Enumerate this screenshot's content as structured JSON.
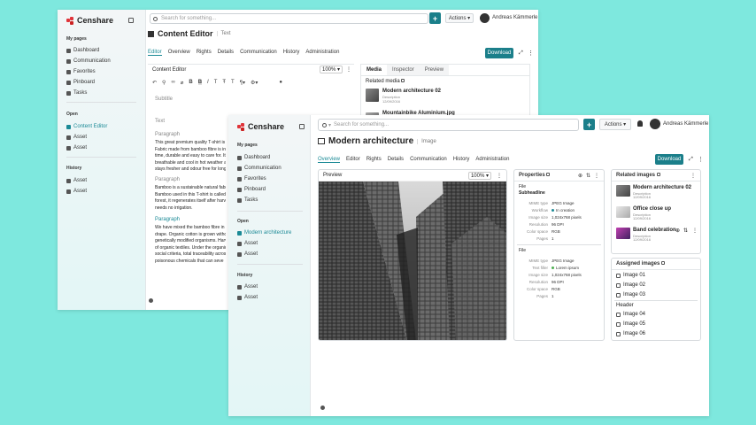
{
  "back": {
    "brand": "Censhare",
    "sidebar": {
      "my_pages_title": "My pages",
      "items": [
        "Dashboard",
        "Communication",
        "Favorites",
        "Pinboard",
        "Tasks"
      ],
      "open_title": "Open",
      "open_items": [
        "Content Editor",
        "Asset",
        "Asset"
      ],
      "history_title": "History",
      "history_items": [
        "Asset",
        "Asset"
      ]
    },
    "search_placeholder": "Search for something...",
    "actions_label": "Actions",
    "user_name": "Andreas Kämmerle",
    "page_title": "Content Editor",
    "type_label": "Text",
    "tabs": [
      "Editor",
      "Overview",
      "Rights",
      "Details",
      "Communication",
      "History",
      "Administration"
    ],
    "download_label": "Download",
    "editor": {
      "panel_title": "Content Editor",
      "zoom": "100%",
      "subtitle_placeholder": "Subtitle",
      "text_label": "Text",
      "paragraph_1_label": "Paragraph",
      "paragraph_1_lines": [
        "This great premium quality T-shirt is",
        "Fabric made from bamboo fibre is inc",
        "time, durable and easy to care for. It's",
        "breathable and cool in hot weather a",
        "stays fresher and odour free for longe"
      ],
      "paragraph_2_label": "Paragraph",
      "paragraph_2_lines": [
        "Bamboo is a sustainable natural fabr",
        "Bamboo used in this T-shirt is called",
        "forest, it regenerates itself after harv",
        "needs no irrigation."
      ],
      "paragraph_3_label": "Paragraph",
      "paragraph_3_lines": [
        "We have mixed the bamboo fibre in t",
        "drape. Organic cotton is grown withou",
        "genetically modified organisms. Harv",
        "of organic textiles. Under the organic",
        "social criteria, total traceability acros",
        "poisonous chemicals that can seve"
      ]
    },
    "media": {
      "tabs": [
        "Media",
        "Inspector",
        "Preview"
      ],
      "related_title": "Related media",
      "items": [
        {
          "name": "Modern architecture 02",
          "desc": "Description",
          "date": "12/09/2016"
        },
        {
          "name": "Mountainbike Aluminium.jpg",
          "desc": "",
          "date": ""
        }
      ]
    }
  },
  "front": {
    "brand": "Censhare",
    "sidebar": {
      "my_pages_title": "My pages",
      "items": [
        "Dashboard",
        "Communication",
        "Favorites",
        "Pinboard",
        "Tasks"
      ],
      "open_title": "Open",
      "open_items": [
        "Modern architecture",
        "Asset",
        "Asset"
      ],
      "history_title": "History",
      "history_items": [
        "Asset",
        "Asset"
      ]
    },
    "search_placeholder": "Search for something...",
    "actions_label": "Actions",
    "user_name": "Andreas Kämmerle",
    "page_title": "Modern architecture",
    "type_label": "Image",
    "tabs": [
      "Overview",
      "Editor",
      "Rights",
      "Details",
      "Communication",
      "History",
      "Administration"
    ],
    "download_label": "Download",
    "preview": {
      "title": "Preview",
      "zoom": "100%"
    },
    "properties": {
      "title": "Properties",
      "file_label_1": "File",
      "subheadline": "Subheadline",
      "block1": [
        {
          "k": "MIME type",
          "v": "JPEG Image"
        },
        {
          "k": "Workflow",
          "v": "In creation",
          "dot": "#1b8a96"
        },
        {
          "k": "Image size",
          "v": "1,024x768 pixels"
        },
        {
          "k": "Resolution",
          "v": "96 DPI"
        },
        {
          "k": "Color space",
          "v": "RGB"
        },
        {
          "k": "Pages",
          "v": "1"
        }
      ],
      "file_label_2": "File",
      "block2": [
        {
          "k": "MIME type",
          "v": "JPEG Image"
        },
        {
          "k": "Text filler",
          "v": "Lorem ipsum",
          "dot": "#4caf50"
        },
        {
          "k": "Image size",
          "v": "1,024x768 pixels"
        },
        {
          "k": "Resolution",
          "v": "96 DPI"
        },
        {
          "k": "Color space",
          "v": "RGB"
        },
        {
          "k": "Pages",
          "v": "1"
        }
      ]
    },
    "related": {
      "title": "Related images",
      "items": [
        {
          "name": "Modern architecture 02",
          "desc": "Description",
          "date": "12/09/2016"
        },
        {
          "name": "Office close up",
          "desc": "Description",
          "date": "12/09/2016"
        },
        {
          "name": "Band celebration",
          "desc": "Description",
          "date": "12/09/2016"
        }
      ]
    },
    "assigned": {
      "title": "Assigned images",
      "group1": [
        "Image 01",
        "Image 02",
        "Image 03"
      ],
      "header_label": "Header",
      "group2": [
        "Image 04",
        "Image 05",
        "Image 06"
      ]
    }
  }
}
